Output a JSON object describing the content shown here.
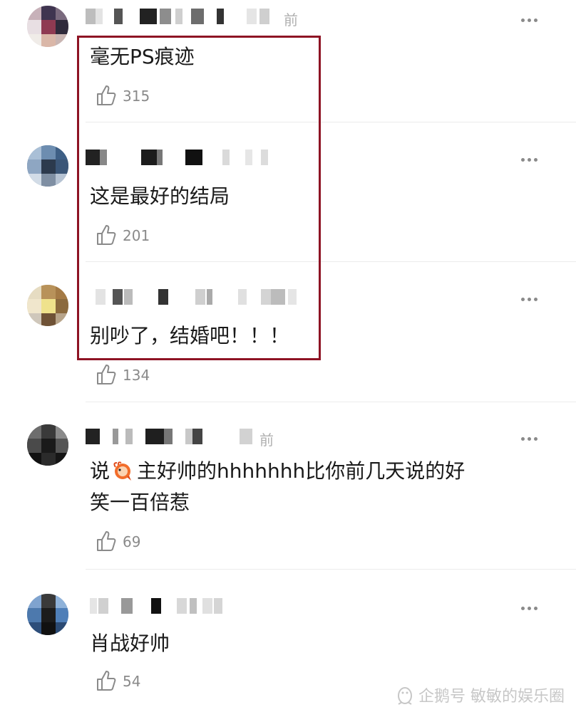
{
  "comments": [
    {
      "time": "前",
      "text": "毫无PS痕迹",
      "likes": "315"
    },
    {
      "time": "",
      "text": "这是最好的结局",
      "likes": "201"
    },
    {
      "time": "",
      "text": "别吵了，结婚吧！！！",
      "likes": "134"
    },
    {
      "time": "前",
      "text_before": "说",
      "text_after": "主好帅的hhhhhhh比你前几天说的好",
      "text_line2": "笑一百倍惹",
      "likes": "69"
    },
    {
      "time": "",
      "text": "肖战好帅",
      "likes": "54"
    }
  ],
  "watermark": "企鹅号 敏敏的娱乐圈",
  "colors": {
    "highlight": "#8e1324",
    "like": "#8a8a8a",
    "divider": "#ececec"
  },
  "icons": [
    "thumbs-up-icon",
    "more-icon",
    "shrimp-emoji-icon",
    "penguin-logo-icon"
  ]
}
